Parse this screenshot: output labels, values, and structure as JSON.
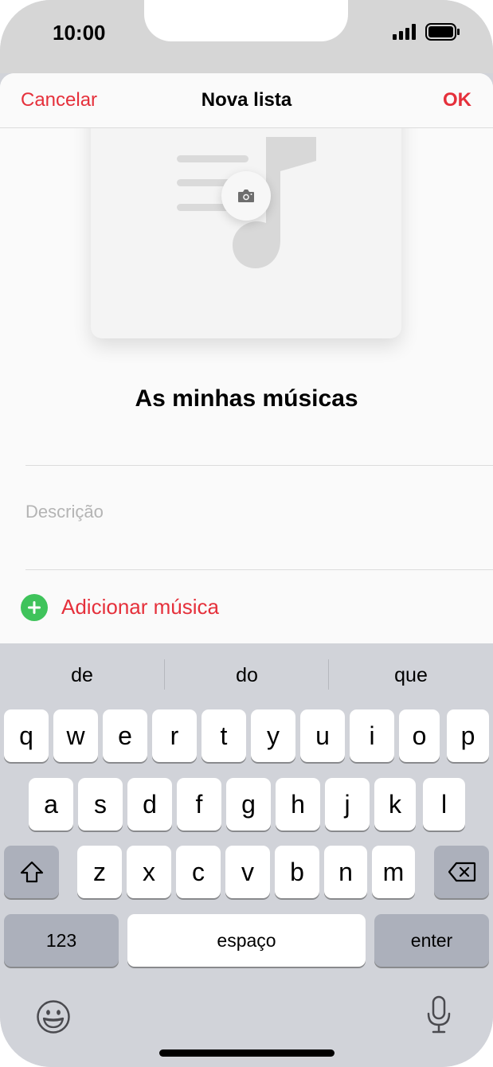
{
  "status_bar": {
    "time": "10:00"
  },
  "nav": {
    "cancel": "Cancelar",
    "title": "Nova lista",
    "ok": "OK"
  },
  "playlist": {
    "title": "As minhas músicas",
    "description_placeholder": "Descrição",
    "add_music": "Adicionar música"
  },
  "keyboard": {
    "suggestions": [
      "de",
      "do",
      "que"
    ],
    "row1": [
      "q",
      "w",
      "e",
      "r",
      "t",
      "y",
      "u",
      "i",
      "o",
      "p"
    ],
    "row2": [
      "a",
      "s",
      "d",
      "f",
      "g",
      "h",
      "j",
      "k",
      "l"
    ],
    "row3": [
      "z",
      "x",
      "c",
      "v",
      "b",
      "n",
      "m"
    ],
    "numbers": "123",
    "space": "espaço",
    "enter": "enter"
  },
  "colors": {
    "accent": "#e5303b",
    "add_green": "#3fc35b",
    "keyboard_bg": "#d1d3d9"
  }
}
